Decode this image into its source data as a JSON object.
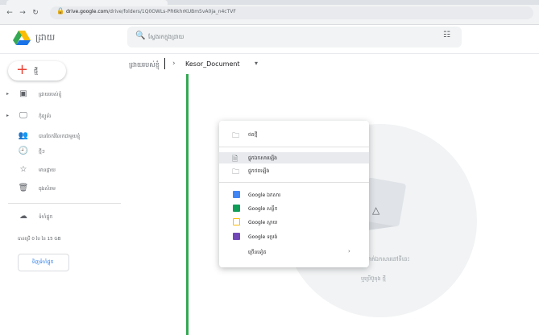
{
  "browser": {
    "url_host": "drive.google.com",
    "url_path": "/drive/folders/1Q0OWLs-PR6khrKUBm5vA0ja_n4cTVF",
    "back_icon": "arrow-left-icon",
    "forward_icon": "arrow-right-icon",
    "reload_icon": "reload-icon"
  },
  "app": {
    "title": "ដ្រាយ",
    "logo_colors": [
      "#1a73e8",
      "#34a853",
      "#fbbc04"
    ]
  },
  "search": {
    "placeholder": "ស្វែងរកក្នុងដ្រាយ"
  },
  "new_button": {
    "label": "ថ្មី"
  },
  "sidebar": {
    "items": [
      {
        "label": "ដ្រាយរបស់ខ្ញុំ",
        "icon": "my-drive-icon",
        "glyph": "▣",
        "arrow": "▸"
      },
      {
        "label": "កុំព្យូទ័រ",
        "icon": "computer-icon",
        "glyph": "🖵",
        "arrow": "▸"
      },
      {
        "label": "បានចែករំលែកជាមួយខ្ញុំ",
        "icon": "people-icon",
        "glyph": "👥",
        "arrow": ""
      },
      {
        "label": "ថ្មីៗ",
        "icon": "clock-icon",
        "glyph": "🕘",
        "arrow": ""
      },
      {
        "label": "មានផ្កាយ",
        "icon": "star-icon",
        "glyph": "☆",
        "arrow": ""
      },
      {
        "label": "ធុងសំរាម",
        "icon": "trash-icon",
        "glyph": "🗑",
        "arrow": ""
      }
    ],
    "storage_label": "ទំហំផ្ទុក",
    "storage_icon": "cloud-icon",
    "storage_text": "បានប្រើ 0 បៃ នៃ 15 GB",
    "buy_storage_label": "ទិញទំហំផ្ទុក"
  },
  "breadcrumb": {
    "root": "ដ្រាយរបស់ខ្ញុំ",
    "separator": "›",
    "current": "Kesor_Document",
    "dropdown_glyph": "▾"
  },
  "empty_state": {
    "line1": "ទម្លាក់ឯកសារនៅទីនេះ",
    "line2": "ឬប្រើប៊ូតុង ថ្មី"
  },
  "context_menu": {
    "items": [
      {
        "label": "ថតថ្មី",
        "icon": "new-folder-icon",
        "glyph": "🗀"
      },
      {
        "label": "ផ្ទុកឯកសារឡើង",
        "icon": "file-upload-icon",
        "glyph": "🗎",
        "highlighted": true
      },
      {
        "label": "ផ្ទុកថតឡើង",
        "icon": "folder-upload-icon",
        "glyph": "🗀"
      },
      {
        "label": "Google ឯកសារ",
        "icon": "google-docs-icon",
        "color": "#4285f4"
      },
      {
        "label": "Google សន្លឹក",
        "icon": "google-sheets-icon",
        "color": "#0f9d58"
      },
      {
        "label": "Google ស្លាយ",
        "icon": "google-slides-icon",
        "color": "#fbbc04"
      },
      {
        "label": "Google ទម្រង់",
        "icon": "google-forms-icon",
        "color": "#7248b9"
      },
      {
        "label": "ច្រើនទៀត",
        "icon": "more-icon",
        "glyph": "",
        "has_submenu": true
      }
    ],
    "submenu_glyph": "›"
  }
}
